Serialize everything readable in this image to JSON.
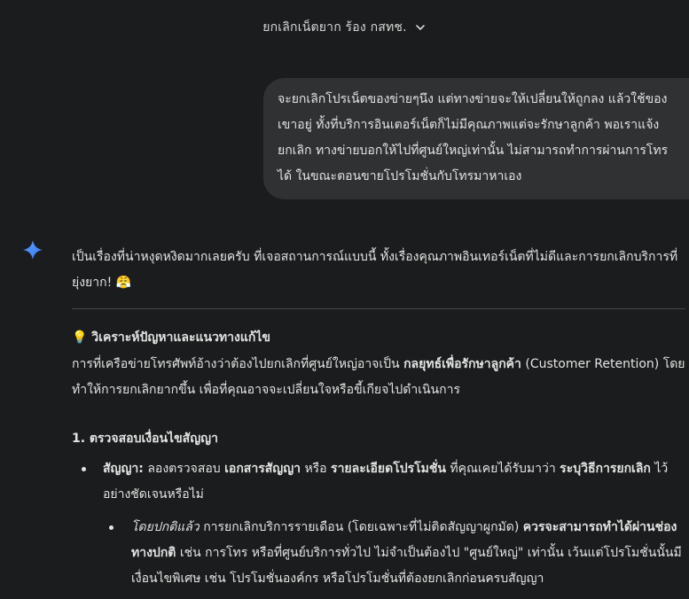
{
  "header": {
    "title": "ยกเลิกเน็ตยาก ร้อง กสทช."
  },
  "user_message": {
    "text": "จะยกเลิกโปรเน็ตของข่ายๆนึง แต่ทางข่ายจะให้เปลี่ยนให้ถูกลง แล้วใช้ของเขาอยู่ ทั้งที่บริการอินเตอร์เน็ตก็ไม่มีคุณภาพแต่จะรักษาลูกค้า พอเราแจ้งยกเลิก ทางข่ายบอกให้ไปที่ศูนย์ใหญ่เท่านั้น ไม่สามารถทำการผ่านการโทรได้ ในขณะตอนขายโปรโมชั่นกับโทรมาหาเอง"
  },
  "response": {
    "intro": "เป็นเรื่องที่น่าหงุดหงิดมากเลยครับ ที่เจอสถานการณ์แบบนี้ ทั้งเรื่องคุณภาพอินเทอร์เน็ตที่ไม่ดีและการยกเลิกบริการที่ยุ่งยาก!",
    "intro_emoji": "😤",
    "analysis_title_icon": "💡",
    "analysis_title": "วิเคราะห์ปัญหาและแนวทางแก้ไข",
    "analysis_p_1": "การที่เครือข่ายโทรศัพท์อ้างว่าต้องไปยกเลิกที่ศูนย์ใหญ่อาจเป็น",
    "analysis_p_bold": "กลยุทธ์เพื่อรักษาลูกค้า",
    "analysis_p_2": "(Customer Retention) โดยทำให้การยกเลิกยากขึ้น เพื่อที่คุณอาจจะเปลี่ยนใจหรือขี้เกียจไปดำเนินการ",
    "section1_title": "1. ตรวจสอบเงื่อนไขสัญญา",
    "bullet1": {
      "label": "สัญญา:",
      "t1": "ลองตรวจสอบ",
      "b1": "เอกสารสัญญา",
      "t2": "หรือ",
      "b2": "รายละเอียดโปรโมชั่น",
      "t3": "ที่คุณเคยได้รับมาว่า",
      "b3": "ระบุวิธีการยกเลิก",
      "t4": "ไว้อย่างชัดเจนหรือไม่"
    },
    "sub_bullet1": {
      "italic": "โดยปกติแล้ว",
      "t1": "การยกเลิกบริการรายเดือน (โดยเฉพาะที่ไม่ติดสัญญาผูกมัด)",
      "b1": "ควรจะสามารถทำได้ผ่านช่องทางปกติ",
      "t2": "เช่น การโทร หรือที่ศูนย์บริการทั่วไป ไม่จำเป็นต้องไป \"ศูนย์ใหญ่\" เท่านั้น เว้นแต่โปรโมชั่นนั้นมีเงื่อนไขพิเศษ เช่น โปรโมชั่นองค์กร หรือโปรโมชั่นที่ต้องยกเลิกก่อนครบสัญญา"
    }
  },
  "colors": {
    "background": "#1b1c1d",
    "user_bubble": "#2f3133",
    "text": "#e3e3e3",
    "divider": "#444746",
    "sparkle": "#4a8cf7"
  },
  "icons": {
    "header_chevron": "chevron-down-icon",
    "assistant_avatar": "sparkle-icon"
  }
}
